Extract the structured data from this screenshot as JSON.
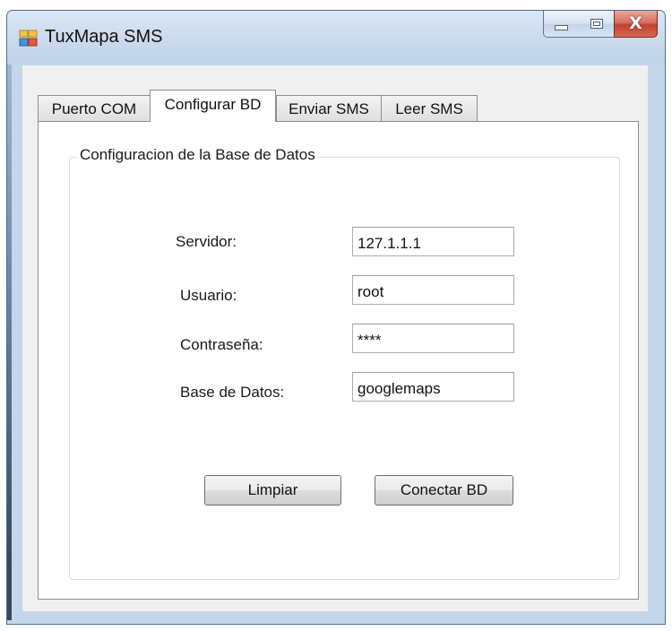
{
  "window": {
    "title": "TuxMapa SMS",
    "controls": {
      "minimize": "minimize",
      "maximize": "maximize",
      "close": "X"
    }
  },
  "tabs": [
    {
      "label": "Puerto COM",
      "active": false
    },
    {
      "label": "Configurar BD",
      "active": true
    },
    {
      "label": "Enviar SMS",
      "active": false
    },
    {
      "label": "Leer SMS",
      "active": false
    }
  ],
  "group": {
    "title": "Configuracion de la Base de Datos"
  },
  "form": {
    "server": {
      "label": "Servidor:",
      "value": "127.1.1.1"
    },
    "user": {
      "label": "Usuario:",
      "value": "root"
    },
    "password": {
      "label": "Contraseña:",
      "value": "****"
    },
    "database": {
      "label": "Base de Datos:",
      "value": "googlemaps"
    }
  },
  "buttons": {
    "clear": "Limpiar",
    "connect": "Conectar BD"
  },
  "colors": {
    "titlebar": "#c3d6ea",
    "client": "#f0f0f0",
    "close_button": "#c1412e"
  },
  "icons": {
    "app": "window-app-icon"
  }
}
